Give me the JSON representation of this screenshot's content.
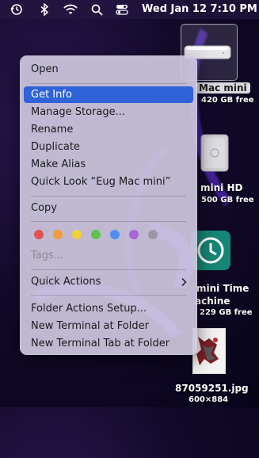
{
  "menubar": {
    "icons": [
      "time-machine-icon",
      "bluetooth-icon",
      "wifi-icon",
      "search-icon",
      "control-center-icon"
    ],
    "datetime": "Wed Jan 12  7:10 PM"
  },
  "desktop": {
    "items": [
      {
        "name": "Mac mini",
        "sub": "420 GB free",
        "icon": "mac-mini-icon",
        "selected": true
      },
      {
        "name": "mini HD",
        "sub": "500 GB free",
        "icon": "hard-drive-icon"
      },
      {
        "name": "mini Time",
        "name2": "achine",
        "sub": "229 GB free",
        "icon": "time-machine-drive-icon"
      },
      {
        "name": "87059251.jpg",
        "sub": "600×884",
        "icon": "image-thumbnail-icon"
      }
    ]
  },
  "context_menu": {
    "open": "Open",
    "get_info": "Get Info",
    "manage_storage": "Manage Storage...",
    "rename": "Rename",
    "duplicate": "Duplicate",
    "make_alias": "Make Alias",
    "quick_look": "Quick Look “Eug Mac mini”",
    "copy": "Copy",
    "tags": "Tags...",
    "quick_actions": "Quick Actions",
    "folder_actions": "Folder Actions Setup...",
    "new_terminal": "New Terminal at Folder",
    "new_terminal_tab": "New Terminal Tab at Folder",
    "tag_colors": [
      "#e0534f",
      "#f39c3d",
      "#f0cf3a",
      "#5cc34f",
      "#4f8ff0",
      "#a866d8",
      "#9a97a3"
    ],
    "highlight_color": "#2f63d7"
  }
}
